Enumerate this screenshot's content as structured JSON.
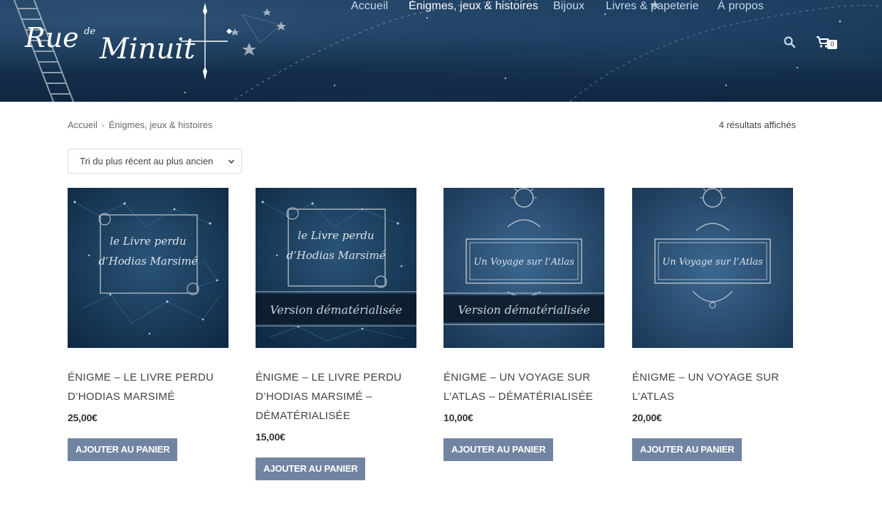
{
  "header": {
    "logo_text": "Rue de Minuit",
    "nav": [
      {
        "label": "Accueil"
      },
      {
        "label": "Énigmes, jeux & histoires"
      },
      {
        "label": "Bijoux"
      },
      {
        "label": "Livres & papeterie"
      },
      {
        "label": "À propos"
      }
    ],
    "cart_count": "0"
  },
  "breadcrumb": {
    "home": "Accueil",
    "separator": "›",
    "current": "Énigmes, jeux & histoires"
  },
  "result_count": "4 résultats affichés",
  "sort": {
    "selected": "Tri du plus récent au plus ancien"
  },
  "products": [
    {
      "title": "Énigme – Le livre perdu d’Hodias Marsimé",
      "price": "25,00€",
      "button": "Ajouter au panier",
      "image_text": [
        "le Livre perdu",
        "d’Hodias Marsimé"
      ]
    },
    {
      "title": "Énigme – Le livre perdu d’Hodias Marsimé – Dématérialisée",
      "price": "15,00€",
      "button": "Ajouter au panier",
      "image_text": [
        "le Livre perdu",
        "d’Hodias Marsimé"
      ],
      "image_banner": "Version dématérialisée"
    },
    {
      "title": "Énigme – Un voyage sur l’Atlas – Dématérialisée",
      "price": "10,00€",
      "button": "Ajouter au panier",
      "image_text": [
        "Un Voyage sur l’Atlas"
      ],
      "image_banner": "Version dématérialisée"
    },
    {
      "title": "Énigme – Un voyage sur l’Atlas",
      "price": "20,00€",
      "button": "Ajouter au panier",
      "image_text": [
        "Un Voyage sur l’Atlas"
      ]
    }
  ],
  "colors": {
    "header_bg": "#173452",
    "button_bg": "#7185a2",
    "nav_text": "#c9d8ea"
  }
}
